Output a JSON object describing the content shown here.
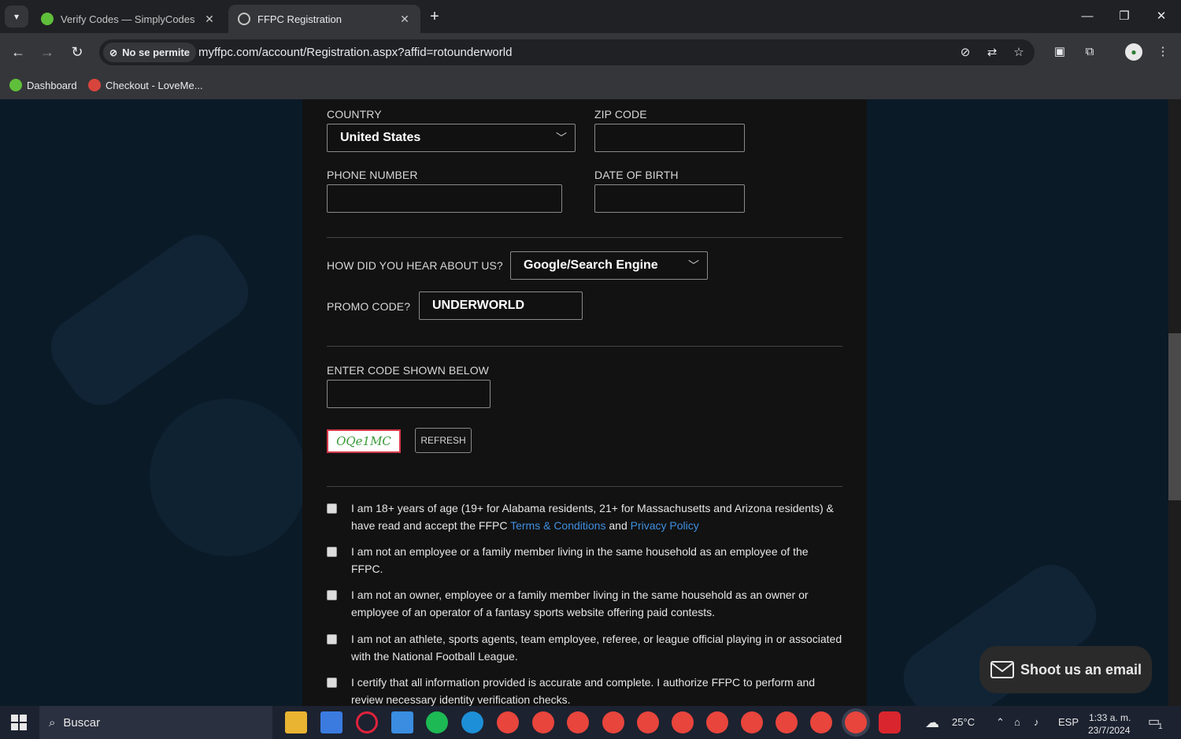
{
  "browser": {
    "tabs": [
      {
        "title": "Verify Codes — SimplyCodes",
        "active": false
      },
      {
        "title": "FFPC Registration",
        "active": true
      }
    ],
    "omnibox": {
      "permission_chip": "No se permite",
      "url": "myffpc.com/account/Registration.aspx?affid=rotounderworld"
    },
    "bookmarks": [
      {
        "label": "Dashboard"
      },
      {
        "label": "Checkout - LoveMe..."
      }
    ]
  },
  "form": {
    "country": {
      "label": "COUNTRY",
      "value": "United States"
    },
    "zip": {
      "label": "ZIP CODE",
      "value": ""
    },
    "phone": {
      "label": "PHONE NUMBER",
      "value": ""
    },
    "dob": {
      "label": "DATE OF BIRTH",
      "value": ""
    },
    "hear": {
      "label": "HOW DID YOU HEAR ABOUT US?",
      "value": "Google/Search Engine"
    },
    "promo": {
      "label": "PROMO CODE?",
      "value": "UNDERWORLD"
    },
    "code": {
      "label": "ENTER CODE SHOWN BELOW",
      "value": "",
      "captcha_text": "OQe1MC",
      "refresh_label": "REFRESH"
    },
    "checkboxes": [
      {
        "text_before": "I am 18+ years of age (19+ for Alabama residents, 21+ for Massachusetts and Arizona residents) & have read and accept the FFPC ",
        "link1": "Terms & Conditions",
        "middle": " and ",
        "link2": "Privacy Policy"
      },
      {
        "text": "I am not an employee or a family member living in the same household as an employee of the FFPC."
      },
      {
        "text": "I am not an owner, employee or a family member living in the same household as an owner or employee of an operator of a fantasy sports website offering paid contests."
      },
      {
        "text": "I am not an athlete, sports agents, team employee, referee, or league official playing in or associated with the National Football League."
      },
      {
        "text": "I certify that all information provided is accurate and complete. I authorize FFPC to perform and review necessary identity verification checks."
      }
    ]
  },
  "chat_widget": {
    "label": "Shoot us an email"
  },
  "taskbar": {
    "search_placeholder": "Buscar",
    "weather": "25°C",
    "language": "ESP",
    "time": "1:33 a. m.",
    "date": "23/7/2024",
    "notification_count": "1"
  },
  "colors": {
    "accent_link": "#3f8fe0",
    "captcha_border": "#d6394a",
    "captcha_text": "#3a9a3a"
  }
}
